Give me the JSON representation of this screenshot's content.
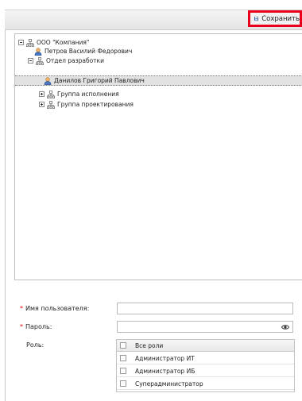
{
  "toolbar": {
    "save_label": "Сохранить",
    "save_icon": "save-icon"
  },
  "tree": {
    "nodes": [
      {
        "label": "ООО \"Компания\"",
        "icon": "org-icon",
        "expander": "minus"
      },
      {
        "label": "Петров Василий Федорович",
        "icon": "user-icon"
      },
      {
        "label": "Отдел разработки",
        "icon": "org-icon",
        "expander": "minus"
      },
      {
        "label": "Данилов Григорий Павлович",
        "icon": "user-icon",
        "selected": true
      },
      {
        "label": "Группа исполнения",
        "icon": "org-icon",
        "expander": "plus"
      },
      {
        "label": "Группа проектирования",
        "icon": "org-icon",
        "expander": "plus"
      }
    ]
  },
  "form": {
    "username": {
      "required_mark": "*",
      "label": "Имя пользователя:",
      "value": ""
    },
    "password": {
      "required_mark": "*",
      "label": "Пароль:",
      "value": "",
      "icon": "eye-icon"
    },
    "role": {
      "label": "Роль:",
      "header": "Все роли",
      "options": [
        "Администратор ИТ",
        "Администратор ИБ",
        "Суперадминистратор"
      ]
    }
  },
  "colors": {
    "highlight": "#e8001c",
    "required": "#e00000",
    "selected_row": "#e2e2e2"
  }
}
